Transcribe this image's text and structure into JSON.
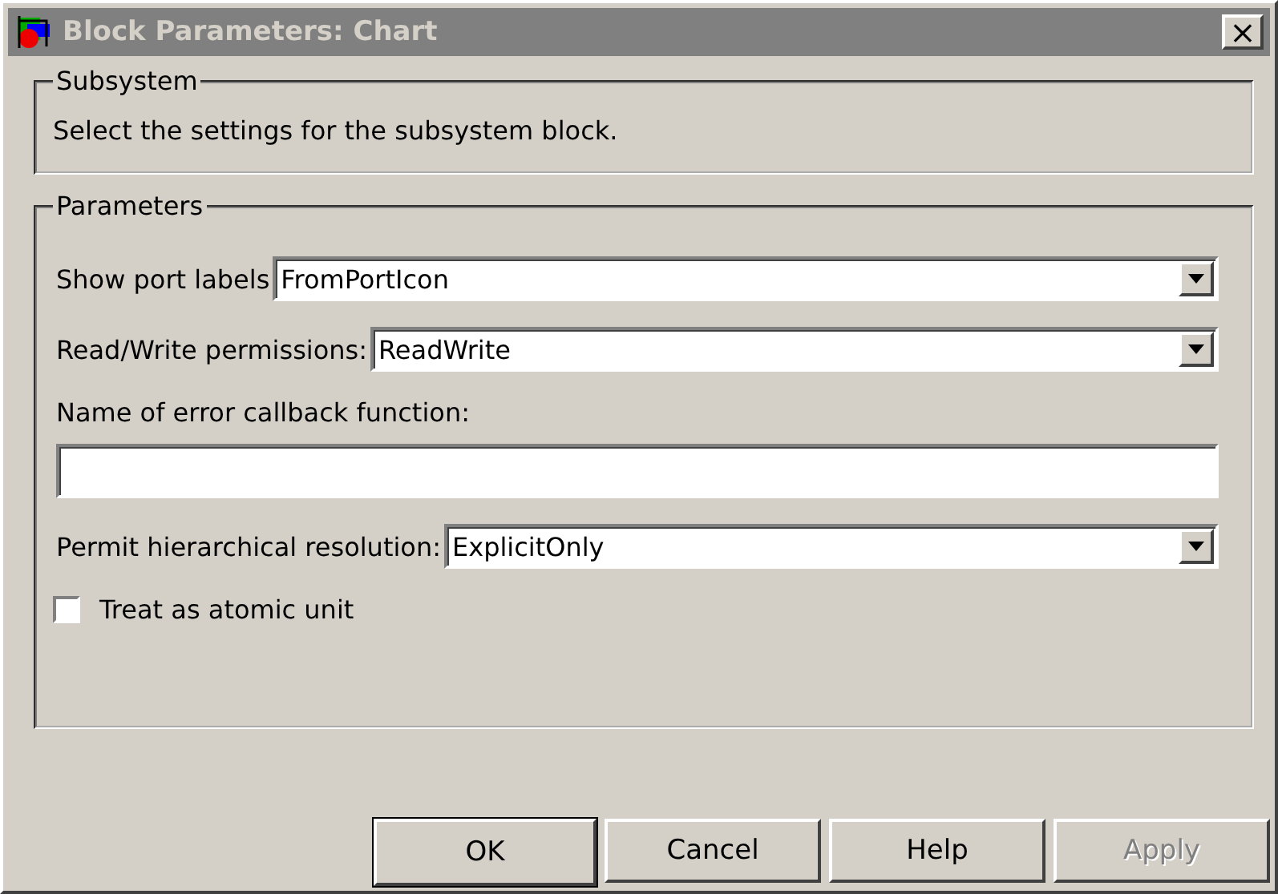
{
  "window": {
    "title": "Block Parameters: Chart",
    "active": false,
    "close": "×"
  },
  "subsystem": {
    "legend": "Subsystem",
    "description": "Select the settings for the subsystem block."
  },
  "parameters": {
    "legend": "Parameters",
    "items": [
      {
        "kind": "dropdown",
        "label": "Show port labels",
        "value": "FromPortIcon"
      },
      {
        "kind": "dropdown",
        "label": "Read/Write permissions:",
        "value": "ReadWrite"
      },
      {
        "kind": "text",
        "label": "Name of error callback function:"
      },
      {
        "kind": "dropdown",
        "label": "Permit hierarchical resolution:",
        "value": "ExplicitOnly"
      },
      {
        "kind": "checkbox",
        "label": "Treat as atomic unit",
        "checked": false
      }
    ]
  },
  "buttons": [
    {
      "label": "OK",
      "disabled": false,
      "default": true
    },
    {
      "label": "Cancel",
      "disabled": false,
      "default": false
    },
    {
      "label": "Help",
      "disabled": false,
      "default": false
    },
    {
      "label": "Apply",
      "disabled": true,
      "default": false
    }
  ]
}
